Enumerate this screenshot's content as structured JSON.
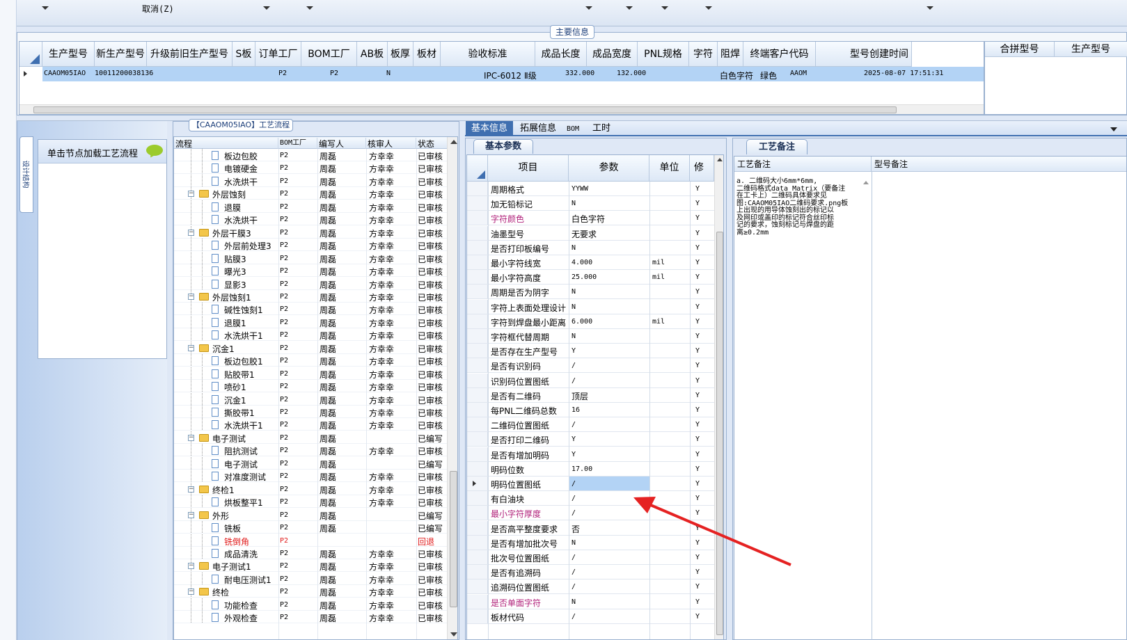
{
  "toolbar": {
    "cancel_label": "取消(Z)"
  },
  "main_info": {
    "title": "主要信息",
    "columns": [
      "生产型号",
      "新生产型号",
      "升级前旧生产型号",
      "S板",
      "订单工厂",
      "BOM工厂",
      "AB板",
      "板厚",
      "板材",
      "验收标准",
      "成品长度",
      "成品宽度",
      "PNL规格",
      "字符",
      "阻焊",
      "终端客户代码",
      "型号创建时间"
    ],
    "row": {
      "prod_no": "CAAOM05IAO",
      "new_prod_no": "10011200038136",
      "order_factory": "P2",
      "bom_factory": "P2",
      "ab": "N",
      "standard": "IPC-6012 Ⅱ级",
      "length": "332.000",
      "width": "132.000",
      "char": "白色字符",
      "mask": "绿色",
      "customer": "AAOM",
      "created": "2025-08-07 17:51:31"
    },
    "side_columns": [
      "合拼型号",
      "生产型号"
    ]
  },
  "left_tab": {
    "label": "设计结构"
  },
  "node_panel": {
    "text": "单击节点加载工艺流程"
  },
  "flow": {
    "title": "【CAAOM05IAO】工艺流程",
    "columns": [
      "流程",
      "BOM工厂",
      "编写人",
      "核审人",
      "状态"
    ],
    "rows": [
      {
        "name": "板边包胶",
        "level": 2,
        "bom": "P2",
        "writer": "周磊",
        "reviewer": "方幸幸",
        "status": "已审核"
      },
      {
        "name": "电镀硬金",
        "level": 2,
        "bom": "P2",
        "writer": "周磊",
        "reviewer": "方幸幸",
        "status": "已审核"
      },
      {
        "name": "水洗烘干",
        "level": 2,
        "bom": "P2",
        "writer": "周磊",
        "reviewer": "方幸幸",
        "status": "已审核"
      },
      {
        "name": "外层蚀刻",
        "level": 1,
        "bom": "P2",
        "writer": "周磊",
        "reviewer": "方幸幸",
        "status": "已审核"
      },
      {
        "name": "退膜",
        "level": 2,
        "bom": "P2",
        "writer": "周磊",
        "reviewer": "方幸幸",
        "status": "已审核"
      },
      {
        "name": "水洗烘干",
        "level": 2,
        "bom": "P2",
        "writer": "周磊",
        "reviewer": "方幸幸",
        "status": "已审核"
      },
      {
        "name": "外层干膜3",
        "level": 1,
        "bom": "P2",
        "writer": "周磊",
        "reviewer": "方幸幸",
        "status": "已审核"
      },
      {
        "name": "外层前处理3",
        "level": 2,
        "bom": "P2",
        "writer": "周磊",
        "reviewer": "方幸幸",
        "status": "已审核"
      },
      {
        "name": "贴膜3",
        "level": 2,
        "bom": "P2",
        "writer": "周磊",
        "reviewer": "方幸幸",
        "status": "已审核"
      },
      {
        "name": "曝光3",
        "level": 2,
        "bom": "P2",
        "writer": "周磊",
        "reviewer": "方幸幸",
        "status": "已审核"
      },
      {
        "name": "显影3",
        "level": 2,
        "bom": "P2",
        "writer": "周磊",
        "reviewer": "方幸幸",
        "status": "已审核"
      },
      {
        "name": "外层蚀刻1",
        "level": 1,
        "bom": "P2",
        "writer": "周磊",
        "reviewer": "方幸幸",
        "status": "已审核"
      },
      {
        "name": "碱性蚀刻1",
        "level": 2,
        "bom": "P2",
        "writer": "周磊",
        "reviewer": "方幸幸",
        "status": "已审核"
      },
      {
        "name": "退膜1",
        "level": 2,
        "bom": "P2",
        "writer": "周磊",
        "reviewer": "方幸幸",
        "status": "已审核"
      },
      {
        "name": "水洗烘干1",
        "level": 2,
        "bom": "P2",
        "writer": "周磊",
        "reviewer": "方幸幸",
        "status": "已审核"
      },
      {
        "name": "沉金1",
        "level": 1,
        "bom": "P2",
        "writer": "周磊",
        "reviewer": "方幸幸",
        "status": "已审核"
      },
      {
        "name": "板边包胶1",
        "level": 2,
        "bom": "P2",
        "writer": "周磊",
        "reviewer": "方幸幸",
        "status": "已审核"
      },
      {
        "name": "贴胶带1",
        "level": 2,
        "bom": "P2",
        "writer": "周磊",
        "reviewer": "方幸幸",
        "status": "已审核"
      },
      {
        "name": "喷砂1",
        "level": 2,
        "bom": "P2",
        "writer": "周磊",
        "reviewer": "方幸幸",
        "status": "已审核"
      },
      {
        "name": "沉金1",
        "level": 2,
        "bom": "P2",
        "writer": "周磊",
        "reviewer": "方幸幸",
        "status": "已审核"
      },
      {
        "name": "撕胶带1",
        "level": 2,
        "bom": "P2",
        "writer": "周磊",
        "reviewer": "方幸幸",
        "status": "已审核"
      },
      {
        "name": "水洗烘干1",
        "level": 2,
        "bom": "P2",
        "writer": "周磊",
        "reviewer": "方幸幸",
        "status": "已审核"
      },
      {
        "name": "电子测试",
        "level": 1,
        "bom": "P2",
        "writer": "周磊",
        "reviewer": "",
        "status": "已编写"
      },
      {
        "name": "阻抗测试",
        "level": 2,
        "bom": "P2",
        "writer": "周磊",
        "reviewer": "方幸幸",
        "status": "已审核"
      },
      {
        "name": "电子测试",
        "level": 2,
        "bom": "P2",
        "writer": "周磊",
        "reviewer": "",
        "status": "已编写"
      },
      {
        "name": "对准度测试",
        "level": 2,
        "bom": "P2",
        "writer": "周磊",
        "reviewer": "方幸幸",
        "status": "已审核"
      },
      {
        "name": "终检1",
        "level": 1,
        "bom": "P2",
        "writer": "周磊",
        "reviewer": "方幸幸",
        "status": "已审核"
      },
      {
        "name": "烘板整平1",
        "level": 2,
        "bom": "P2",
        "writer": "周磊",
        "reviewer": "方幸幸",
        "status": "已审核"
      },
      {
        "name": "外形",
        "level": 1,
        "bom": "P2",
        "writer": "周磊",
        "reviewer": "",
        "status": "已编写"
      },
      {
        "name": "铣板",
        "level": 2,
        "bom": "P2",
        "writer": "周磊",
        "reviewer": "",
        "status": "已编写"
      },
      {
        "name": "铣倒角",
        "level": 2,
        "bom": "P2",
        "writer": "",
        "reviewer": "",
        "status": "回退",
        "red": true
      },
      {
        "name": "成品清洗",
        "level": 2,
        "bom": "P2",
        "writer": "周磊",
        "reviewer": "方幸幸",
        "status": "已审核"
      },
      {
        "name": "电子测试1",
        "level": 1,
        "bom": "P2",
        "writer": "周磊",
        "reviewer": "方幸幸",
        "status": "已审核"
      },
      {
        "name": "耐电压测试1",
        "level": 2,
        "bom": "P2",
        "writer": "周磊",
        "reviewer": "方幸幸",
        "status": "已审核"
      },
      {
        "name": "终检",
        "level": 1,
        "bom": "P2",
        "writer": "周磊",
        "reviewer": "方幸幸",
        "status": "已审核"
      },
      {
        "name": "功能检查",
        "level": 2,
        "bom": "P2",
        "writer": "周磊",
        "reviewer": "方幸幸",
        "status": "已审核"
      },
      {
        "name": "外观检查",
        "level": 2,
        "bom": "P2",
        "writer": "周磊",
        "reviewer": "方幸幸",
        "status": "已审核"
      }
    ]
  },
  "tabs": [
    "基本信息",
    "拓展信息",
    "BOM",
    "工时"
  ],
  "params": {
    "subtab": "基本参数",
    "columns": [
      "项目",
      "参数",
      "单位",
      "修"
    ],
    "rows": [
      {
        "item": "周期格式",
        "value": "YYWW",
        "unit": "",
        "mod": "Y"
      },
      {
        "item": "加无铅标记",
        "value": "N",
        "unit": "",
        "mod": "Y"
      },
      {
        "item": "字符颜色",
        "value": "白色字符",
        "unit": "",
        "mod": "Y",
        "purple": true
      },
      {
        "item": "油墨型号",
        "value": "无要求",
        "unit": "",
        "mod": "Y"
      },
      {
        "item": "是否打印板编号",
        "value": "N",
        "unit": "",
        "mod": "Y"
      },
      {
        "item": "最小字符线宽",
        "value": "4.000",
        "unit": "mil",
        "mod": "Y"
      },
      {
        "item": "最小字符高度",
        "value": "25.000",
        "unit": "mil",
        "mod": "Y"
      },
      {
        "item": "周期是否为阴字",
        "value": "N",
        "unit": "",
        "mod": "Y"
      },
      {
        "item": "字符上表面处理设计",
        "value": "N",
        "unit": "",
        "mod": "Y"
      },
      {
        "item": "字符到焊盘最小距离",
        "value": "6.000",
        "unit": "mil",
        "mod": "Y"
      },
      {
        "item": "字符框代替周期",
        "value": "N",
        "unit": "",
        "mod": "Y"
      },
      {
        "item": "是否存在生产型号",
        "value": "Y",
        "unit": "",
        "mod": "Y"
      },
      {
        "item": "是否有识别码",
        "value": "/",
        "unit": "",
        "mod": "Y"
      },
      {
        "item": "识别码位置图纸",
        "value": "/",
        "unit": "",
        "mod": "Y"
      },
      {
        "item": "是否有二维码",
        "value": "顶层",
        "unit": "",
        "mod": "Y"
      },
      {
        "item": "每PNL二维码总数",
        "value": "16",
        "unit": "",
        "mod": "Y"
      },
      {
        "item": "二维码位置图纸",
        "value": "/",
        "unit": "",
        "mod": "Y"
      },
      {
        "item": "是否打印二维码",
        "value": "Y",
        "unit": "",
        "mod": "Y"
      },
      {
        "item": "是否有增加明码",
        "value": "Y",
        "unit": "",
        "mod": "Y"
      },
      {
        "item": "明码位数",
        "value": "17.00",
        "unit": "",
        "mod": "Y"
      },
      {
        "item": "明码位置图纸",
        "value": "/",
        "unit": "",
        "mod": "Y",
        "selected": true
      },
      {
        "item": "有白油块",
        "value": "/",
        "unit": "",
        "mod": "Y"
      },
      {
        "item": "最小字符厚度",
        "value": "/",
        "unit": "",
        "mod": "Y",
        "purple": true
      },
      {
        "item": "是否高平整度要求",
        "value": "否",
        "unit": "",
        "mod": "Y"
      },
      {
        "item": "是否有增加批次号",
        "value": "N",
        "unit": "",
        "mod": "Y"
      },
      {
        "item": "批次号位置图纸",
        "value": "/",
        "unit": "",
        "mod": "Y"
      },
      {
        "item": "是否有追溯码",
        "value": "/",
        "unit": "",
        "mod": "Y"
      },
      {
        "item": "追溯码位置图纸",
        "value": "/",
        "unit": "",
        "mod": "Y"
      },
      {
        "item": "是否单面字符",
        "value": "N",
        "unit": "",
        "mod": "Y",
        "purple": true
      },
      {
        "item": "板材代码",
        "value": "/",
        "unit": "",
        "mod": "Y"
      }
    ]
  },
  "remarks": {
    "tab": "工艺备注",
    "col1": "工艺备注",
    "col2": "型号备注",
    "lines": [
      "a.        二维码大小6mm*6mm,",
      "二维码格式data Matrix（要备注",
      "在工卡上）二维码具体要求见",
      "图:CAAOM05IAO二维码要求.png板",
      "上出现的用导体蚀刻出的标记以",
      "及网印或盖印的标记符合丝印标",
      "记的要求，蚀刻标记与焊盘的距",
      "离≥0.2mm"
    ]
  },
  "colors": {
    "accent": "#3f6fb0",
    "selected": "#b3d3f5",
    "purple": "#b0207a",
    "arrow": "#e52222"
  }
}
